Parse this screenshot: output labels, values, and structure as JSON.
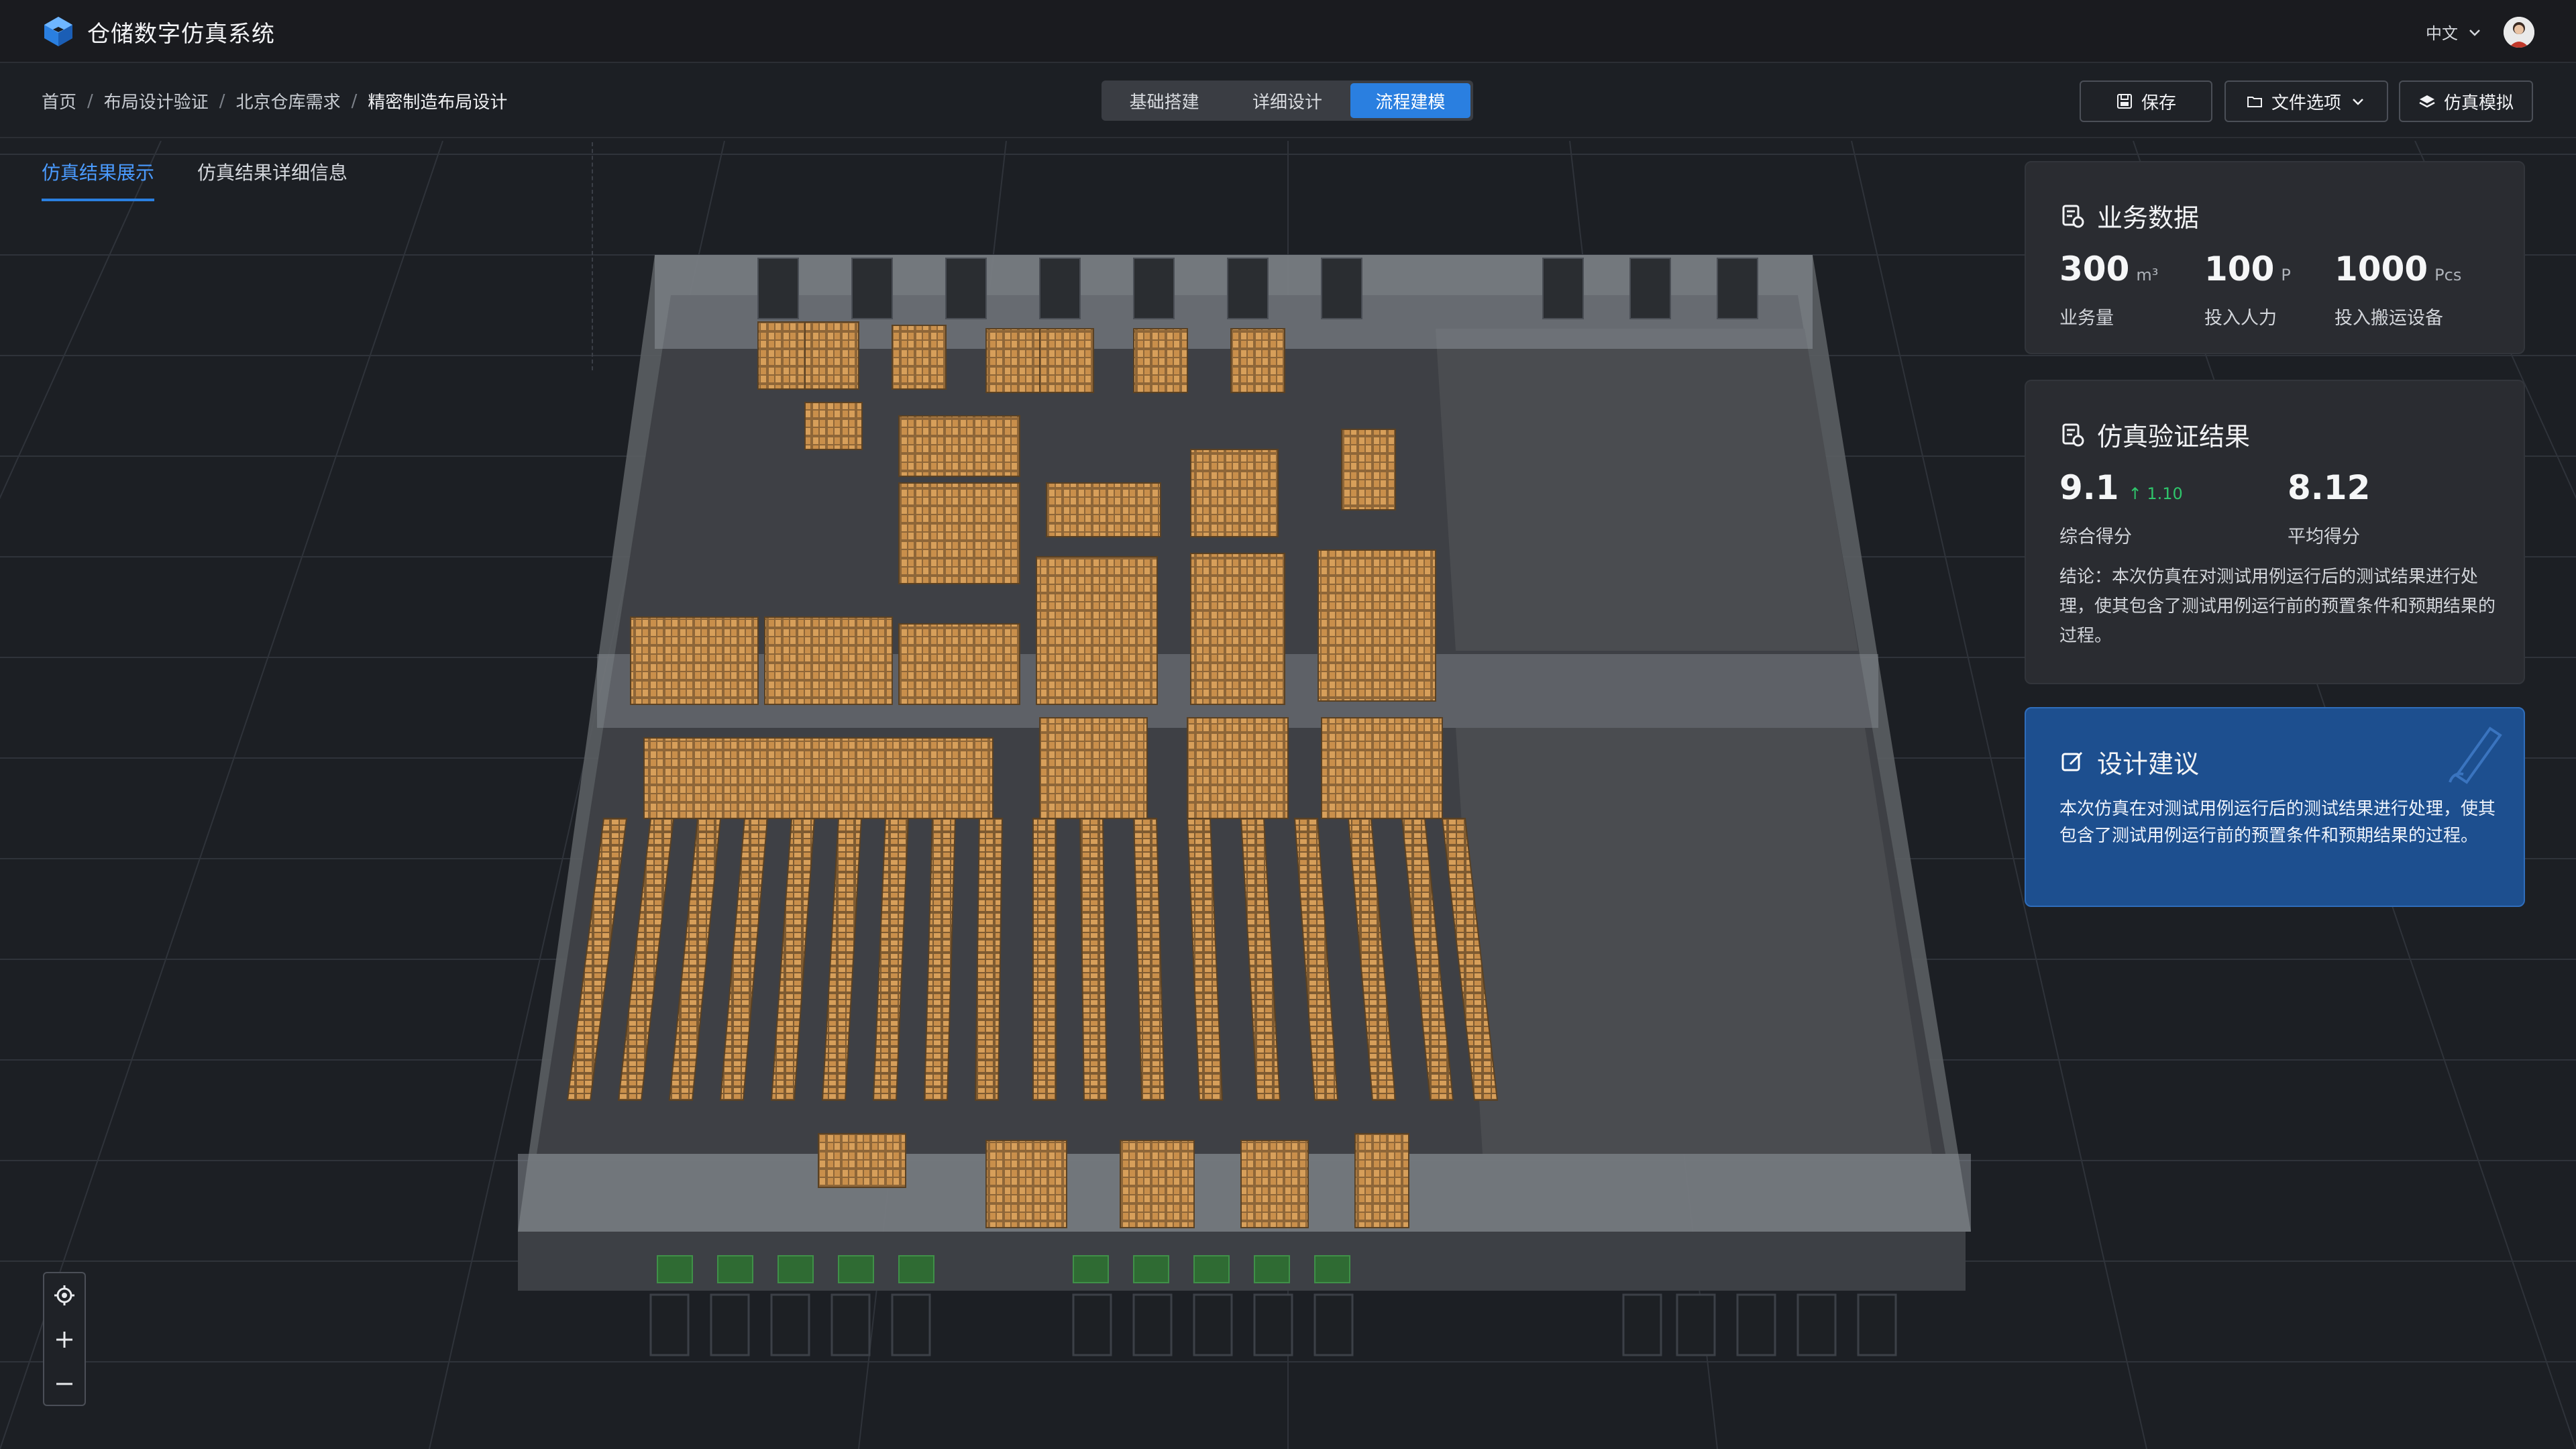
{
  "app": {
    "title": "仓储数字仿真系统",
    "language": "中文"
  },
  "breadcrumb": [
    "首页",
    "布局设计验证",
    "北京仓库需求",
    "精密制造布局设计"
  ],
  "modes": {
    "items": [
      "基础搭建",
      "详细设计",
      "流程建模"
    ],
    "active": "流程建模"
  },
  "toolbar": {
    "save_label": "保存",
    "file_label": "文件选项",
    "simulate_label": "仿真模拟"
  },
  "tabs": {
    "items": [
      "仿真结果展示",
      "仿真结果详细信息"
    ],
    "active": "仿真结果展示"
  },
  "business": {
    "title": "业务数据",
    "metrics": [
      {
        "value": "300",
        "unit": "m³",
        "label": "业务量"
      },
      {
        "value": "100",
        "unit": "P",
        "label": "投入人力"
      },
      {
        "value": "1000",
        "unit": "Pcs",
        "label": "投入搬运设备"
      }
    ]
  },
  "result": {
    "title": "仿真验证结果",
    "score": {
      "value": "9.1",
      "trend": "1.10",
      "label": "综合得分"
    },
    "avg": {
      "value": "8.12",
      "label": "平均得分"
    },
    "conclusion": "结论：本次仿真在对测试用例运行后的测试结果进行处理，使其包含了测试用例运行前的预置条件和预期结果的过程。"
  },
  "suggestion": {
    "title": "设计建议",
    "text": "本次仿真在对测试用例运行后的测试结果进行处理，使其包含了测试用例运行前的预置条件和预期结果的过程。"
  },
  "colors": {
    "accent": "#2a7fe0",
    "card": "#2a2c31",
    "suggest": "#1d4f8f",
    "rack": "#c9924f",
    "floor": "#4a4c50"
  },
  "icons": [
    "app-logo-icon",
    "chevron-down-icon",
    "save-icon",
    "folder-icon",
    "layers-icon",
    "report-icon",
    "edit-icon",
    "locate-icon",
    "plus-icon",
    "minus-icon"
  ]
}
